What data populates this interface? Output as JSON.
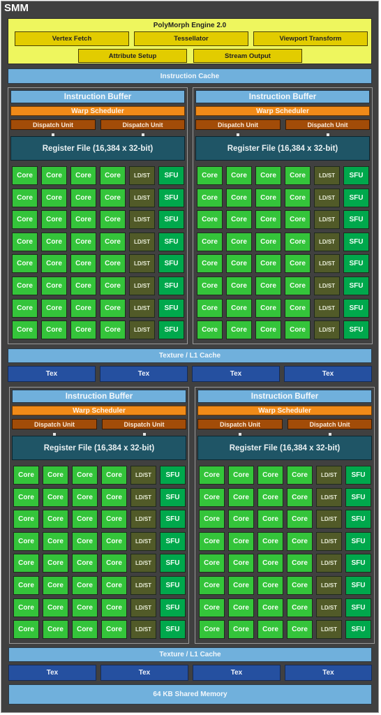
{
  "title": "SMM",
  "polymorph": {
    "title": "PolyMorph Engine 2.0",
    "row1": [
      "Vertex Fetch",
      "Tessellator",
      "Viewport Transform"
    ],
    "row2": [
      "Attribute Setup",
      "Stream Output"
    ]
  },
  "instruction_cache": "Instruction Cache",
  "processing_block": {
    "instruction_buffer": "Instruction Buffer",
    "warp_scheduler": "Warp Scheduler",
    "dispatch_units": [
      "Dispatch Unit",
      "Dispatch Unit"
    ],
    "register_file": "Register File (16,384 x 32-bit)",
    "rows": 8,
    "row_units": [
      "Core",
      "Core",
      "Core",
      "Core",
      "LD/ST",
      "SFU"
    ]
  },
  "processing_blocks_count": 4,
  "texture_l1_cache": "Texture / L1 Cache",
  "tex_units": [
    "Tex",
    "Tex",
    "Tex",
    "Tex"
  ],
  "shared_memory": "64 KB Shared Memory",
  "colors": {
    "frame": "#404040",
    "polymorph_bg": "#eef65e",
    "polymorph_unit": "#e2cc00",
    "cache": "#70b0dc",
    "tex": "#2550a0",
    "warp_scheduler": "#f08a18",
    "dispatch_unit": "#a24c08",
    "register_file": "#1f5566",
    "core": "#34c43a",
    "ldst": "#515a28",
    "sfu": "#00a84c"
  }
}
